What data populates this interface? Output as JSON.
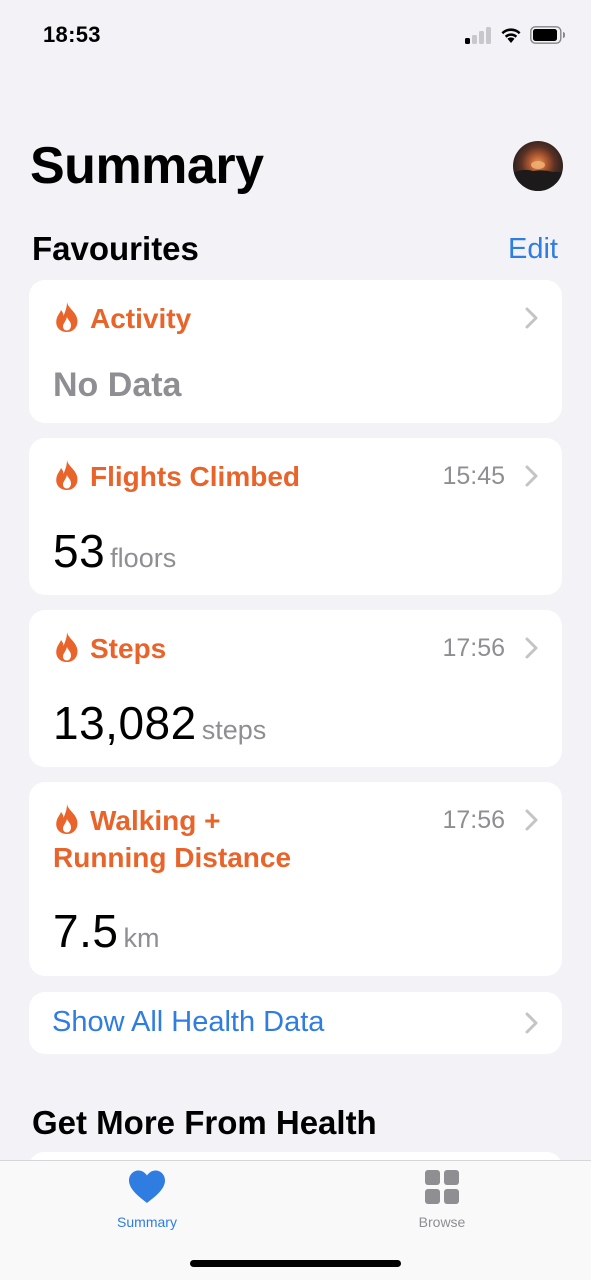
{
  "status_bar": {
    "time": "18:53",
    "signal_icon": "cellular-signal-icon",
    "wifi_icon": "wifi-icon",
    "battery_icon": "battery-icon"
  },
  "header": {
    "title": "Summary",
    "avatar": "profile-avatar"
  },
  "favourites": {
    "title": "Favourites",
    "edit_label": "Edit",
    "cards": [
      {
        "title": "Activity",
        "time": "",
        "no_data": "No Data",
        "icon": "flame-icon"
      },
      {
        "title": "Flights Climbed",
        "time": "15:45",
        "value": "53",
        "unit": "floors",
        "icon": "flame-icon"
      },
      {
        "title": "Steps",
        "time": "17:56",
        "value": "13,082",
        "unit": "steps",
        "icon": "flame-icon"
      },
      {
        "title_line1": "Walking +",
        "title_line2": "Running Distance",
        "time": "17:56",
        "value": "7.5",
        "unit": "km",
        "icon": "flame-icon"
      }
    ],
    "show_all_label": "Show All Health Data"
  },
  "more_section": {
    "title": "Get More From Health"
  },
  "tab_bar": {
    "tabs": [
      {
        "label": "Summary",
        "icon": "heart-icon",
        "active": true
      },
      {
        "label": "Browse",
        "icon": "grid-icon",
        "active": false
      }
    ]
  },
  "colors": {
    "accent_blue": "#2f7de1",
    "activity_orange": "#e8642a",
    "secondary_gray": "#8e8e93",
    "background": "#f2f2f7"
  }
}
